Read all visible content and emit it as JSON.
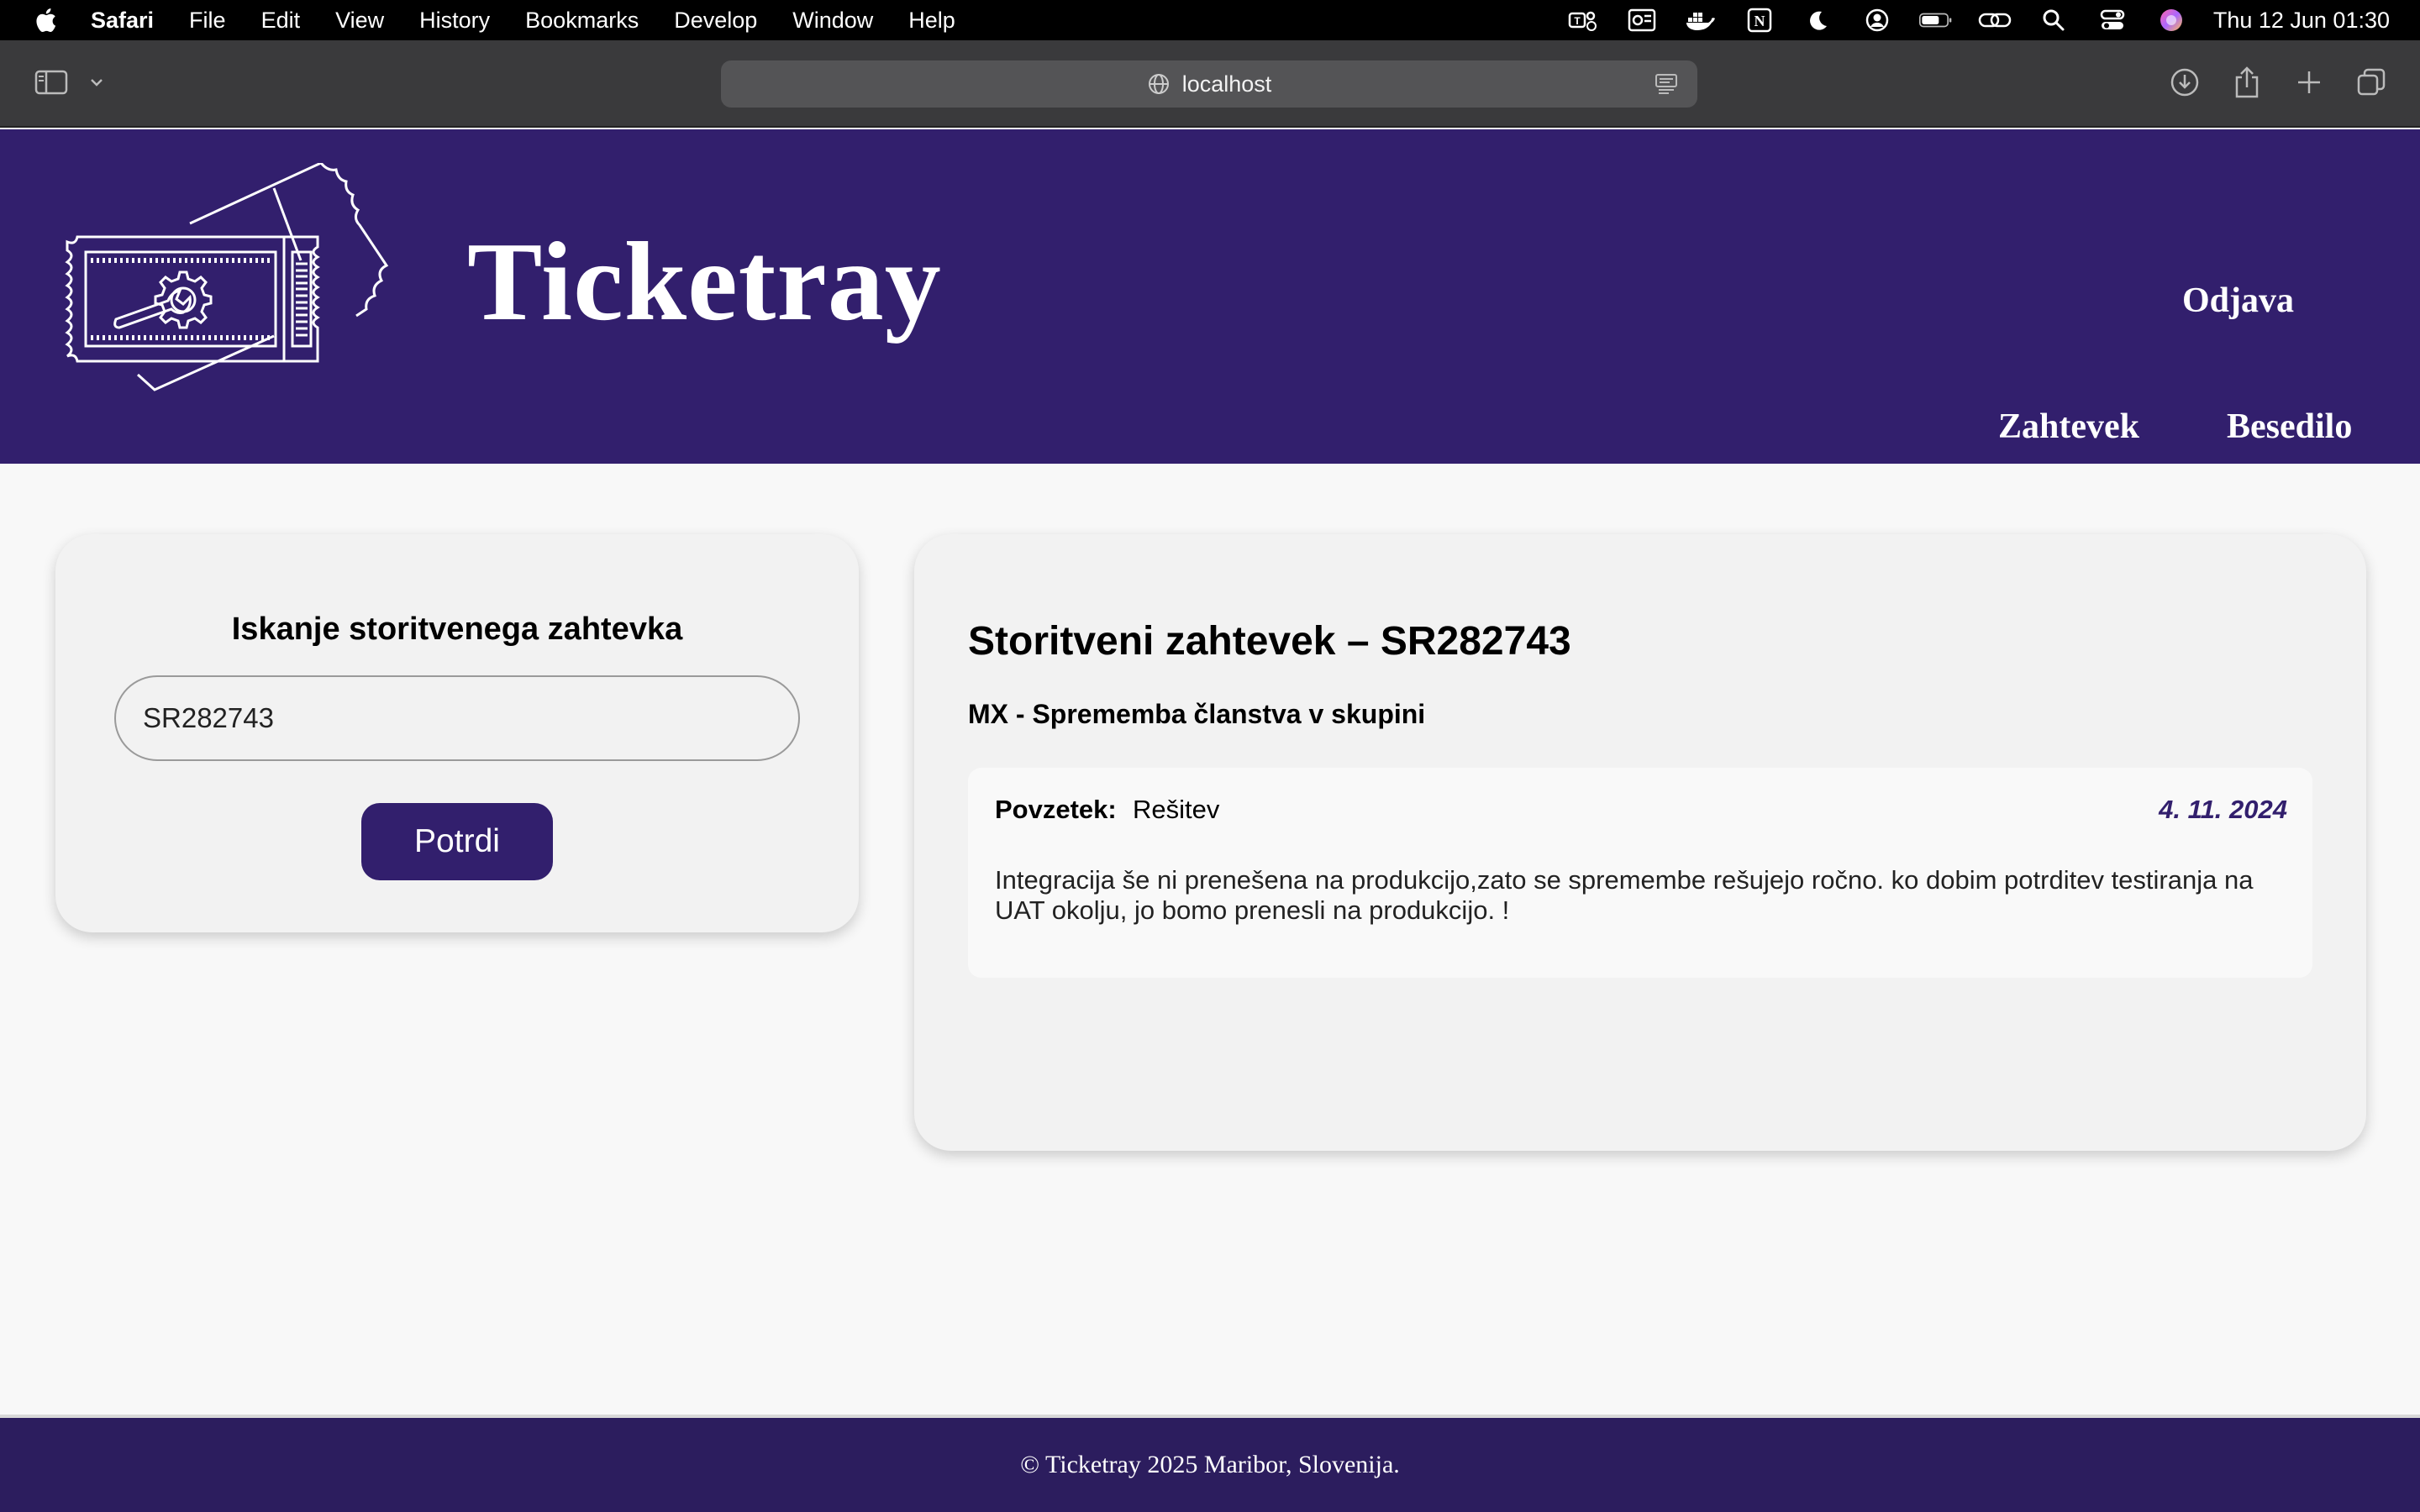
{
  "menubar": {
    "app_name": "Safari",
    "items": [
      "File",
      "Edit",
      "View",
      "History",
      "Bookmarks",
      "Develop",
      "Window",
      "Help"
    ],
    "clock": "Thu 12 Jun  01:30"
  },
  "browser": {
    "url": "localhost"
  },
  "header": {
    "brand": "Ticketray",
    "logout": "Odjava",
    "nav_request": "Zahtevek",
    "nav_text": "Besedilo",
    "color": "#321f6d"
  },
  "search": {
    "title": "Iskanje storitvenega zahtevka",
    "input_value": "SR282743",
    "submit_label": "Potrdi"
  },
  "detail": {
    "title": "Storitveni zahtevek – SR282743",
    "subtitle": "MX - Sprememba članstva v skupini",
    "entry": {
      "label": "Povzetek:",
      "type": "Rešitev",
      "date": "4. 11. 2024",
      "text": "Integracija še ni prenešena na produkcijo,zato se spremembe rešujejo ročno. ko dobim potrditev testiranja na UAT okolju, jo bomo prenesli na produkcijo. !"
    }
  },
  "footer": {
    "text": "© Ticketray 2025 Maribor, Slovenija."
  }
}
